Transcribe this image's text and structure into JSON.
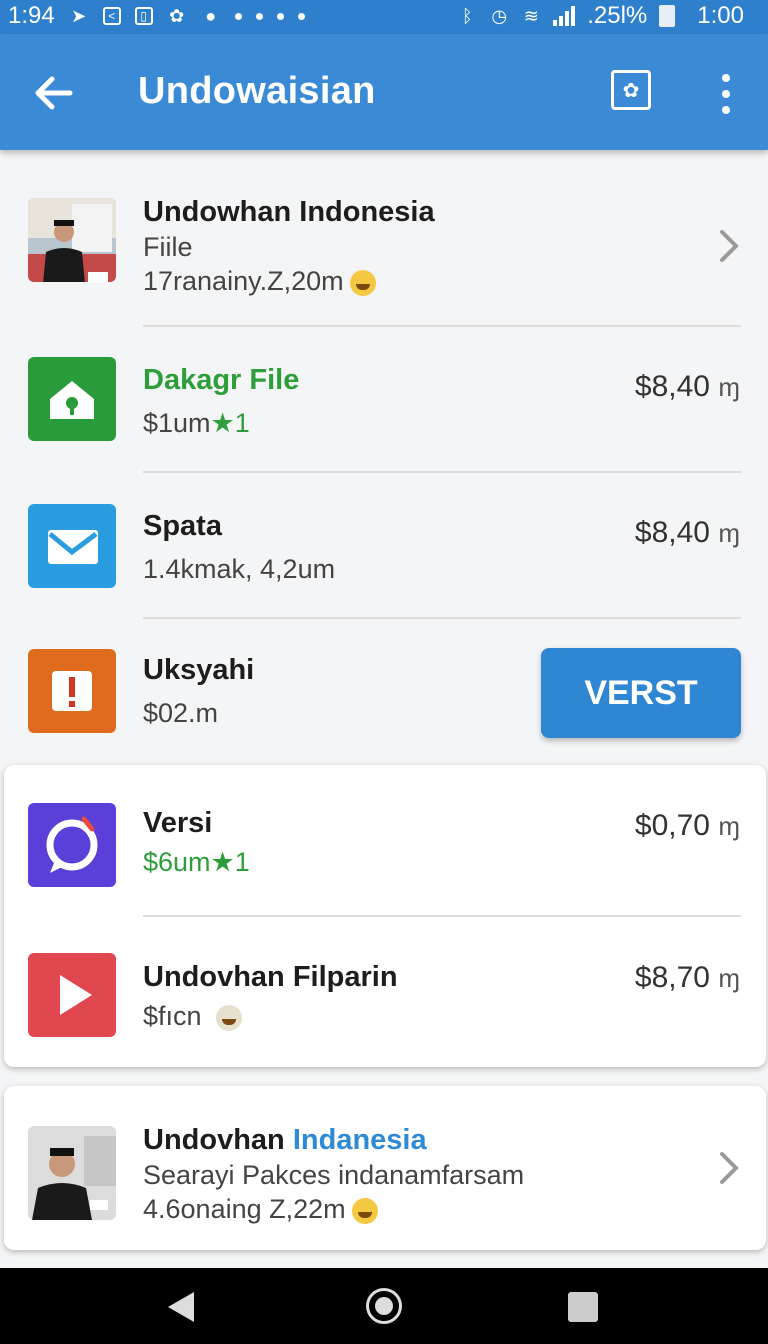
{
  "status_bar": {
    "time_left": "1:94",
    "battery_text": ".25l%",
    "time_right": "1:00"
  },
  "app_bar": {
    "title": "Undowaisian"
  },
  "rows": [
    {
      "title": "Undowhan Indonesia",
      "line2": "Fiile",
      "line3": "17ranainy.Z,20m"
    },
    {
      "title": "Dakagr File",
      "line2": "$1um",
      "line2_suffix": "★1",
      "price": "$8,40",
      "price_unit": "ɱ"
    },
    {
      "title": "Spata",
      "line2": "1.4kmak, 4,2um",
      "price": "$8,40",
      "price_unit": "ɱ"
    },
    {
      "title": "Uksyahi",
      "line2": "$02.m",
      "button": "VERST"
    },
    {
      "title": "Versi",
      "line2": "$6um",
      "line2_suffix": "★1",
      "price": "$0,70",
      "price_unit": "ɱ"
    },
    {
      "title": "Undovhan Filparin",
      "line2": "$fıcn",
      "price": "$8,70",
      "price_unit": "ɱ"
    },
    {
      "title_a": "Undovhan",
      "title_b": "Indanesia",
      "line2": "Searayi Pakces indanamfarsam",
      "line3": "4.6onaing Z,22m"
    }
  ],
  "colors": {
    "app_bar": "#3a8ad6",
    "accent_green": "#2e9e3a",
    "button_blue": "#2f86d3"
  },
  "icons": {
    "row1": "person-photo",
    "row2": "home-icon",
    "row3": "mail-icon",
    "row4": "alert-icon",
    "row5": "chat-bubble-icon",
    "row6": "play-icon",
    "row7": "person-photo"
  }
}
